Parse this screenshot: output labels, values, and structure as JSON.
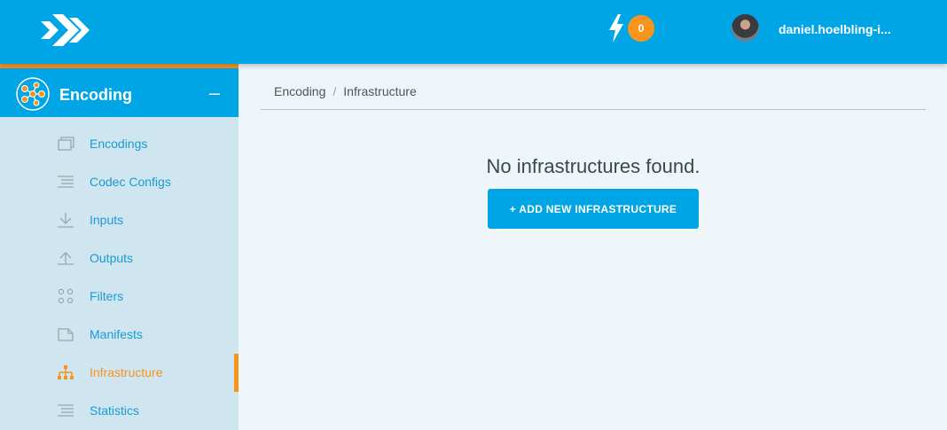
{
  "header": {
    "notification_count": "0",
    "username": "daniel.hoelbling-i..."
  },
  "sidebar": {
    "module_title": "Encoding",
    "collapse_symbol": "–",
    "items": [
      {
        "label": "Encodings",
        "icon": "encodings-icon"
      },
      {
        "label": "Codec Configs",
        "icon": "codec-configs-icon"
      },
      {
        "label": "Inputs",
        "icon": "inputs-icon"
      },
      {
        "label": "Outputs",
        "icon": "outputs-icon"
      },
      {
        "label": "Filters",
        "icon": "filters-icon"
      },
      {
        "label": "Manifests",
        "icon": "manifests-icon"
      },
      {
        "label": "Infrastructure",
        "icon": "infrastructure-icon",
        "active": true
      },
      {
        "label": "Statistics",
        "icon": "statistics-icon"
      }
    ]
  },
  "breadcrumb": {
    "root": "Encoding",
    "separator": "/",
    "current": "Infrastructure"
  },
  "main": {
    "empty_message": "No infrastructures found.",
    "add_button_label": "+ ADD NEW INFRASTRUCTURE"
  },
  "colors": {
    "brand_blue": "#00a5e6",
    "accent_orange": "#f7941d",
    "sidebar_bg": "#cfe6f0",
    "content_bg": "#eef6fa"
  }
}
